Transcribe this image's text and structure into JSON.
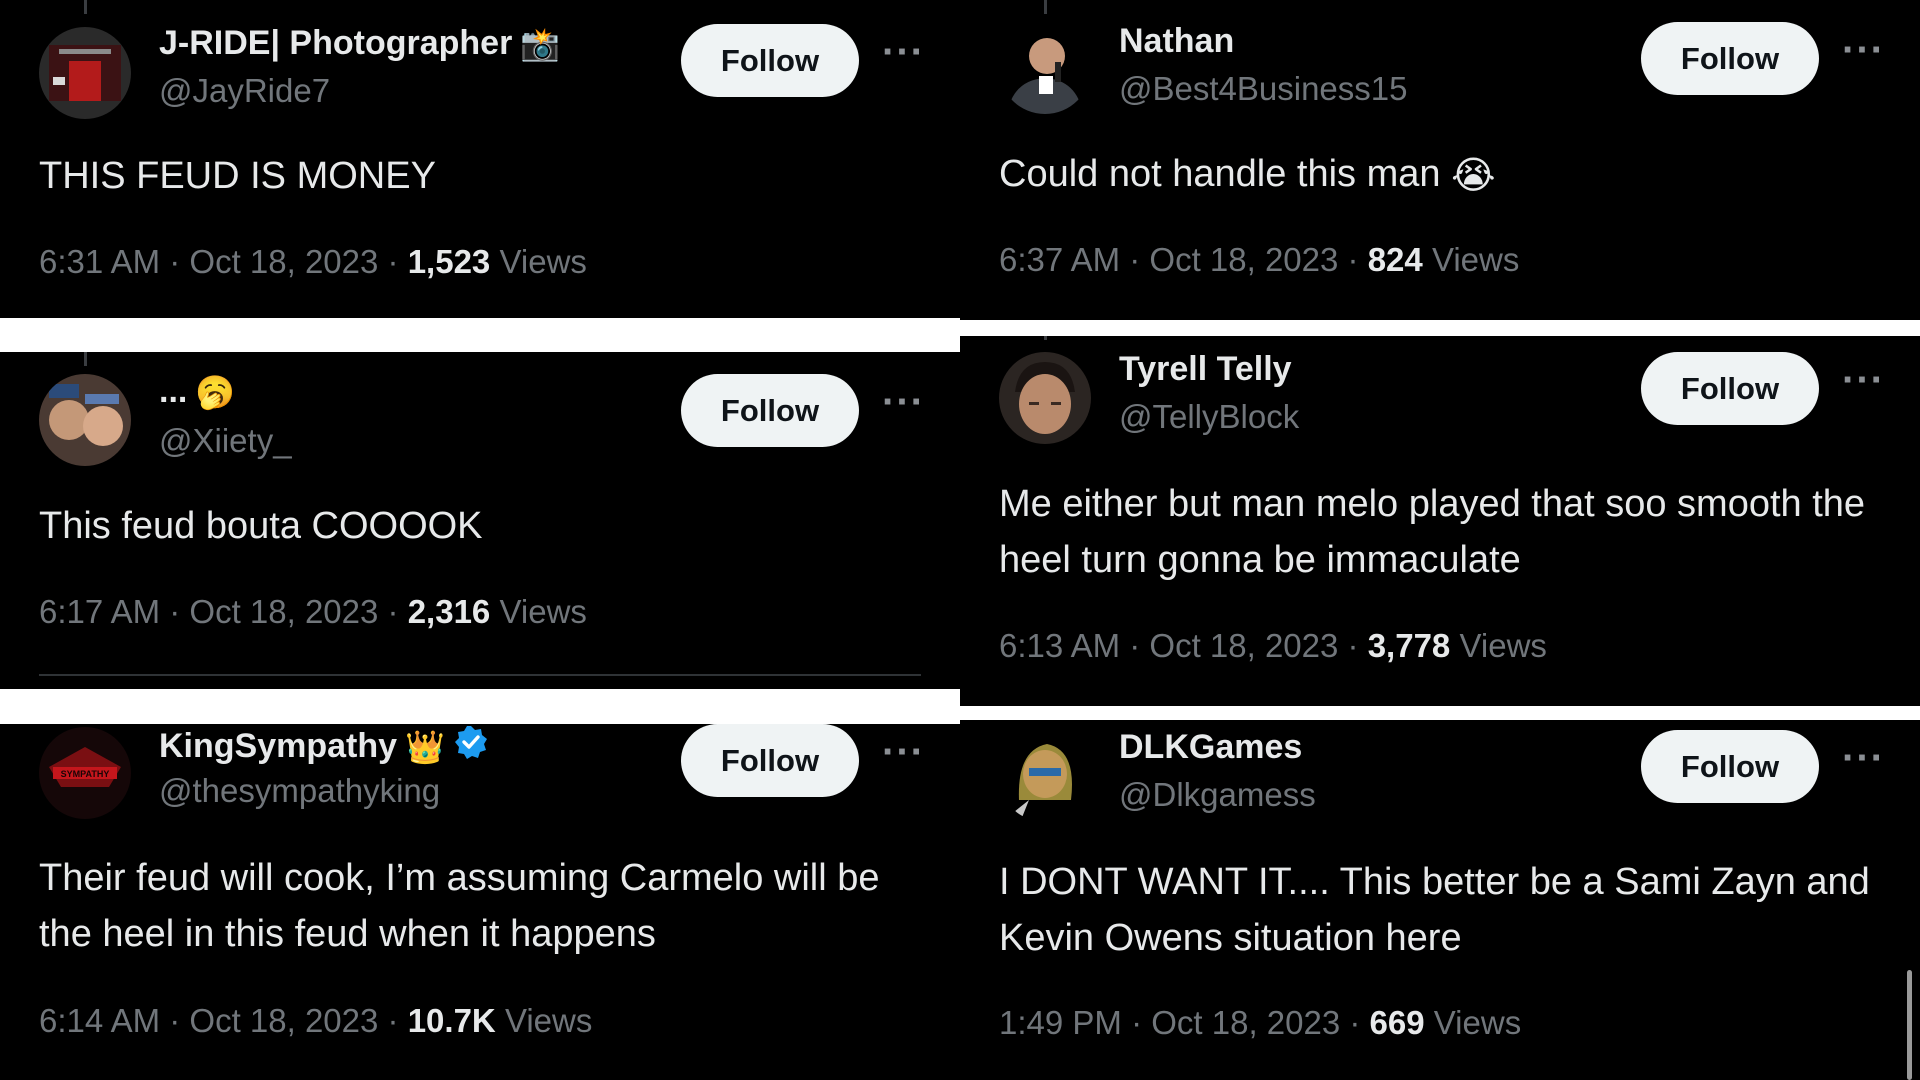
{
  "follow_label": "Follow",
  "more_label": "···",
  "views_label": "Views",
  "tweets": [
    {
      "name": "J-RIDE| Photographer",
      "name_emoji": "📸",
      "handle": "@JayRide7",
      "text": "THIS FEUD IS MONEY",
      "time": "6:31 AM",
      "date": "Oct 18, 2023",
      "views": "1,523"
    },
    {
      "name": "Nathan",
      "handle": "@Best4Business15",
      "text": "Could not handle this man",
      "text_emoji": "😭",
      "time": "6:37 AM",
      "date": "Oct 18, 2023",
      "views": "824"
    },
    {
      "name": "...",
      "name_emoji": "🥱",
      "handle": "@Xiiety_",
      "text": "This feud bouta COOOOK",
      "time": "6:17 AM",
      "date": "Oct 18, 2023",
      "views": "2,316"
    },
    {
      "name": "Tyrell Telly",
      "handle": "@TellyBlock",
      "text": "Me either but man melo played that soo smooth the heel turn gonna be immaculate",
      "time": "6:13 AM",
      "date": "Oct 18, 2023",
      "views": "3,778"
    },
    {
      "name": "KingSympathy",
      "name_emoji": "👑",
      "verified": true,
      "handle": "@thesympathyking",
      "text": "Their feud will cook, I’m assuming Carmelo will be the heel in this feud when it happens",
      "time": "6:14 AM",
      "date": "Oct 18, 2023",
      "views": "10.7K"
    },
    {
      "name": "DLKGames",
      "handle": "@Dlkgamess",
      "text": "I DONT WANT IT.... This better be a Sami Zayn and Kevin Owens situation here",
      "time": "1:49 PM",
      "date": "Oct 18, 2023",
      "views": "669"
    }
  ],
  "colors": {
    "background": "#000000",
    "text": "#e7e9ea",
    "muted": "#71767b",
    "follow_bg": "#eff3f4",
    "verified": "#1d9bf0"
  }
}
